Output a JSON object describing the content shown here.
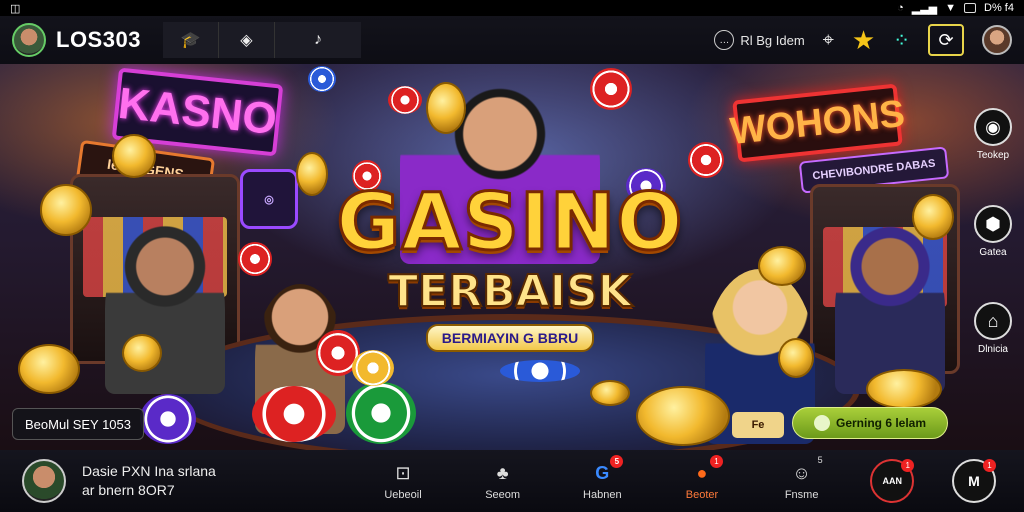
{
  "status_bar": {
    "left_glyph": "◫",
    "right_text": "D% f4"
  },
  "app": {
    "brand": "LOS303"
  },
  "top_nav": [
    {
      "icon": "cap-icon",
      "glyph": "🎓"
    },
    {
      "icon": "diamond-icon",
      "glyph": "◈"
    },
    {
      "icon": "music-icon",
      "glyph": "♪"
    }
  ],
  "top_right": {
    "link_label": "Rl Bg Idem",
    "link_icon": "chat-icon",
    "tag_icon": "tag-icon",
    "star_icon": "star-icon",
    "dots_icon": "dots-icon",
    "refresh_icon": "refresh-icon"
  },
  "hero": {
    "neon_kasno": "KASNO",
    "neon_le": "Ie RlI GENS",
    "neon_wohons": "WOHONS",
    "neon_chev": "CHEVIBONDRE DABAS",
    "title": "GASINO",
    "subtitle": "TERBAISK",
    "tagline": "BERMIAYIN G BBRU",
    "left_pill": "BeoMul SEY 1053",
    "small_badge": "Fe",
    "cta_label": "Gerning 6 lelam",
    "cta_icon": "shield-icon"
  },
  "side_rail": [
    {
      "label": "Teokep",
      "icon": "avatar-icon",
      "glyph": "◉"
    },
    {
      "label": "Gatea",
      "icon": "gear-icon",
      "glyph": "⬢"
    },
    {
      "label": "Dlnicia",
      "icon": "house-icon",
      "glyph": "⌂"
    }
  ],
  "bottom": {
    "user_line1": "Dasie PXN Ina srlana",
    "user_line2": "ar bnern 8OR7",
    "nav": [
      {
        "label": "Uebeoil",
        "icon": "controller-icon",
        "glyph": "⊡",
        "badge": ""
      },
      {
        "label": "Seeom",
        "icon": "group-icon",
        "glyph": "♣",
        "badge": ""
      },
      {
        "label": "Habnen",
        "icon": "g-icon",
        "glyph": "G",
        "badge": "5"
      },
      {
        "label": "Beoter",
        "icon": "chart-icon",
        "glyph": "●",
        "badge": "1"
      },
      {
        "label": "Fnsme",
        "icon": "face-icon",
        "glyph": "☺",
        "badge": "5"
      }
    ],
    "round_1_text": "AAN",
    "round_1_badge": "1",
    "round_2_text": "M",
    "round_2_badge": "1"
  },
  "colors": {
    "accent": "#f5c518",
    "cta": "#8ab82a",
    "neon_pink": "#d63fd6",
    "neon_red": "#e33333"
  }
}
